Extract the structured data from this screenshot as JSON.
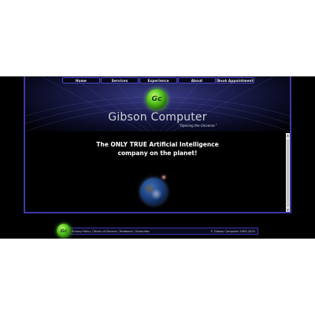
{
  "nav": {
    "items": [
      {
        "label": "Home"
      },
      {
        "label": "Services"
      },
      {
        "label": "Experience"
      },
      {
        "label": "About"
      },
      {
        "label": "Book Appointment"
      }
    ]
  },
  "header": {
    "logo_letter": "Gc",
    "brand_name": "Gibson Computer",
    "tagline": "\"Opening the Universe.\""
  },
  "main": {
    "headline_line1": "The ONLY TRUE Artificial Intelligence",
    "headline_line2": "company on the planet!",
    "image_icon": "earth-icon"
  },
  "footer": {
    "logo_letter": "Gc",
    "links": [
      {
        "label": "Privacy Policy"
      },
      {
        "label": "Terms of Service"
      },
      {
        "label": "Feedback"
      },
      {
        "label": "Subscribe"
      }
    ],
    "separator": "|",
    "copyright": "© Gibson Computer 2005-2025"
  },
  "colors": {
    "accent": "#3d3aa8",
    "logo_green": "#55c21d",
    "background": "#000000"
  }
}
